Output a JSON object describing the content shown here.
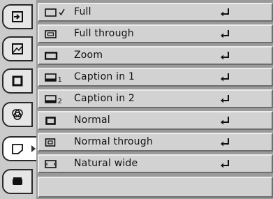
{
  "tabs": [
    {
      "name": "input-tab",
      "icon": "input-icon"
    },
    {
      "name": "image-select-tab",
      "icon": "image-icon"
    },
    {
      "name": "image-adjust-tab",
      "icon": "screen-icon"
    },
    {
      "name": "color-tab",
      "icon": "color-icon"
    },
    {
      "name": "screen-tab",
      "icon": "screen-shape-icon",
      "active": true
    },
    {
      "name": "setting-tab",
      "icon": "projector-icon"
    }
  ],
  "menu": {
    "items": [
      {
        "label": "Full",
        "checked": true,
        "icon": "full-icon"
      },
      {
        "label": "Full through",
        "checked": false,
        "icon": "full-through-icon"
      },
      {
        "label": "Zoom",
        "checked": false,
        "icon": "zoom-icon"
      },
      {
        "label": "Caption in 1",
        "checked": false,
        "icon": "caption1-icon",
        "badge": "1"
      },
      {
        "label": "Caption in 2",
        "checked": false,
        "icon": "caption2-icon",
        "badge": "2"
      },
      {
        "label": "Normal",
        "checked": false,
        "icon": "normal-icon"
      },
      {
        "label": "Normal through",
        "checked": false,
        "icon": "normal-through-icon"
      },
      {
        "label": "Natural wide",
        "checked": false,
        "icon": "natural-wide-icon"
      }
    ]
  }
}
